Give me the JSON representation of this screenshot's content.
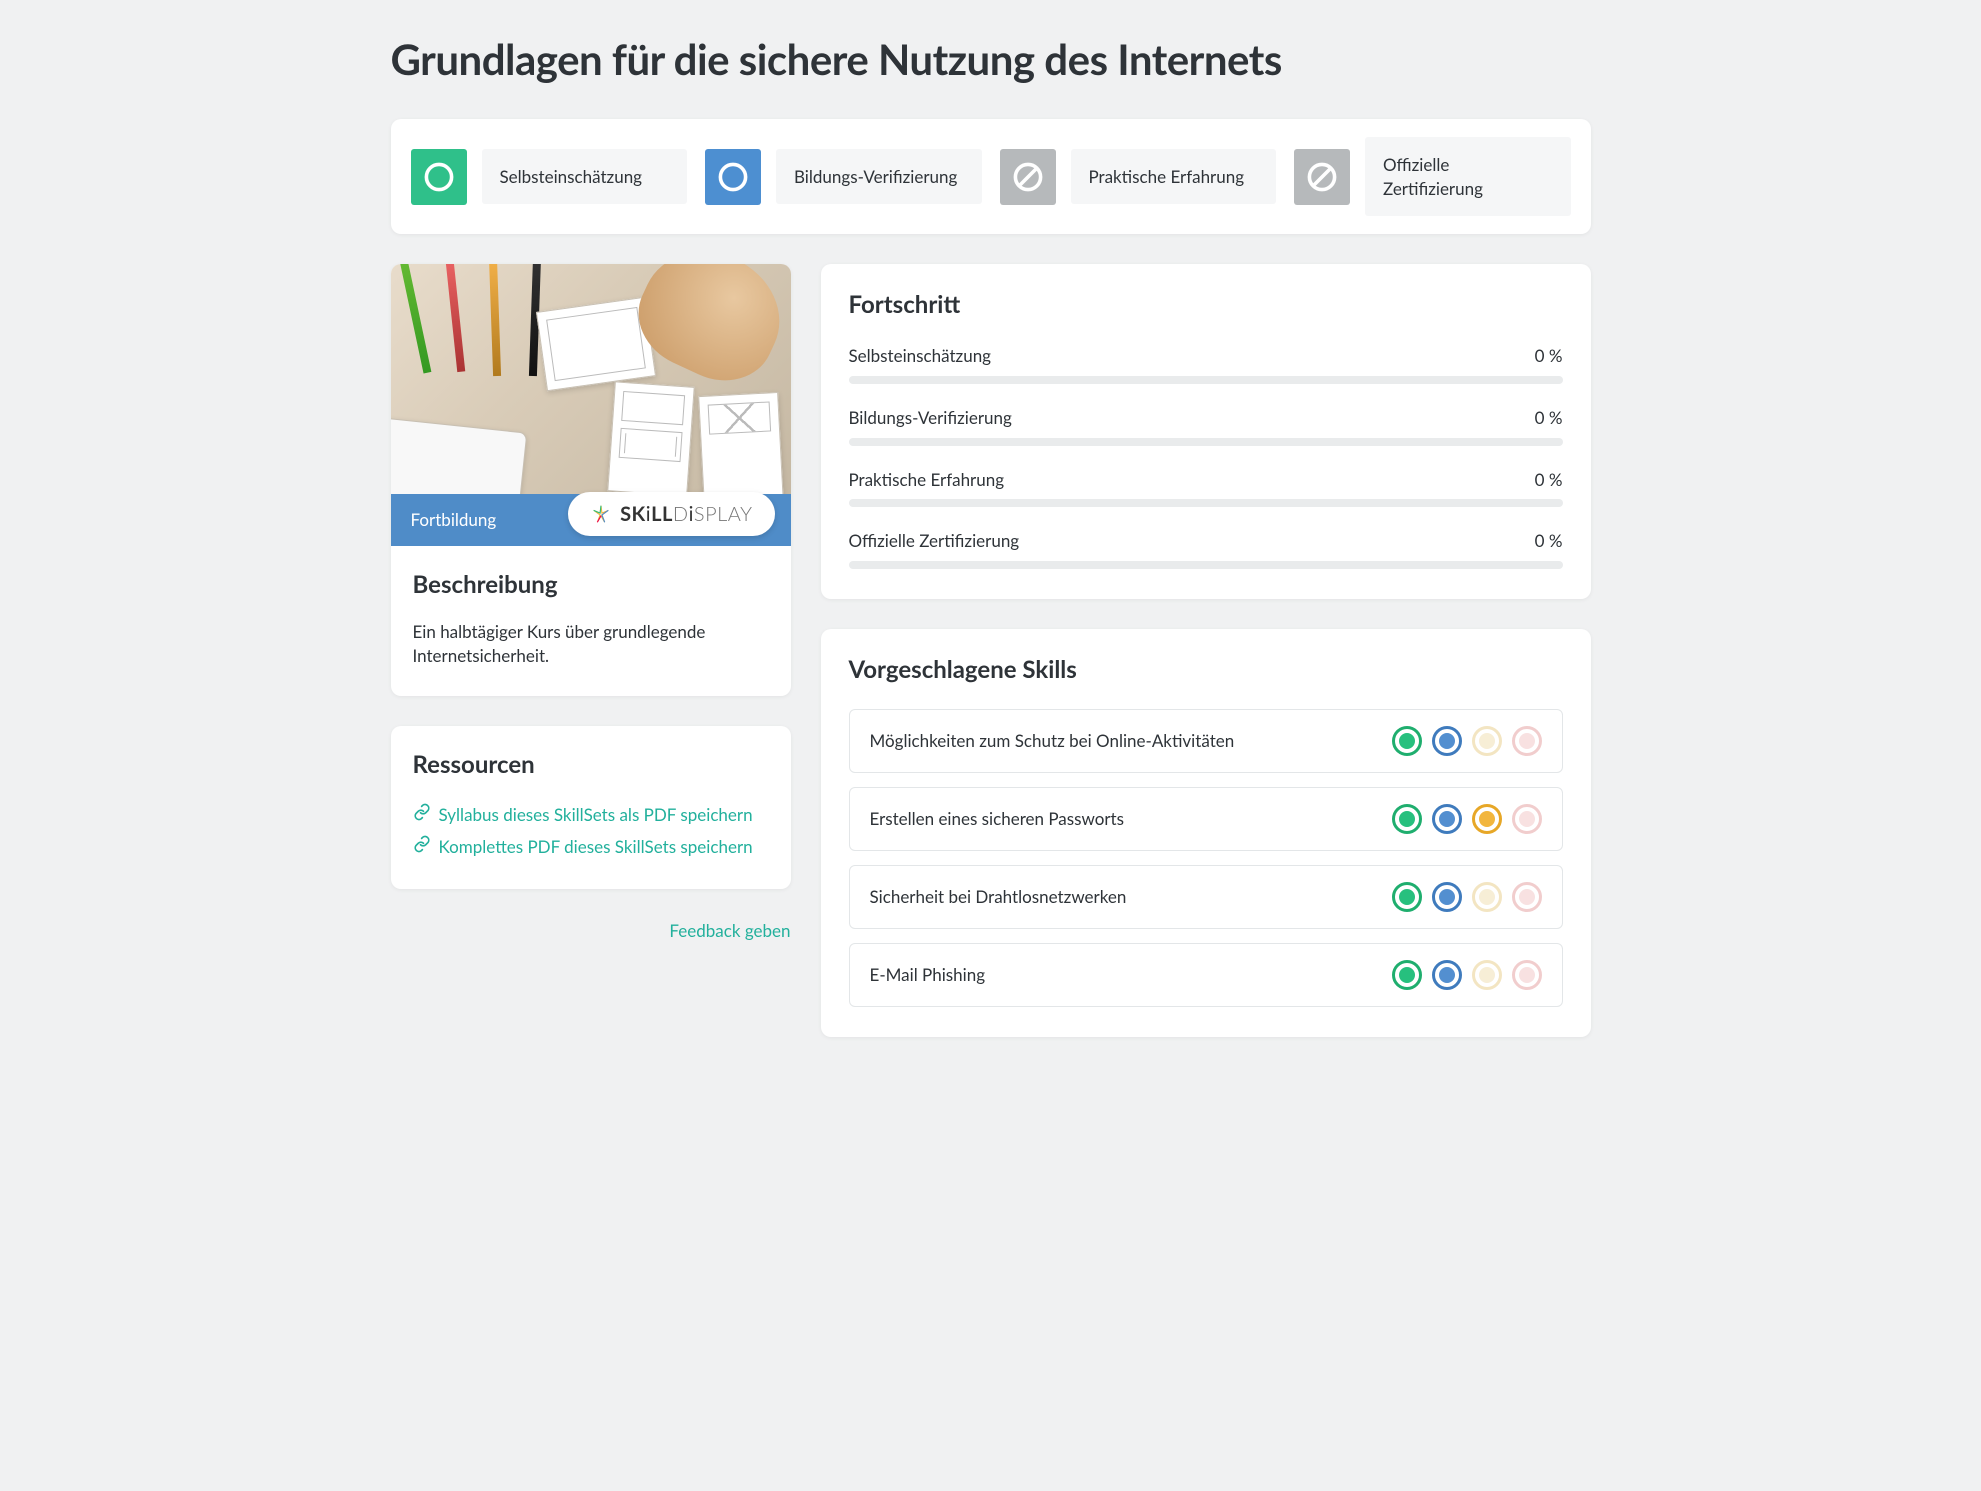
{
  "page": {
    "title": "Grundlagen für die sichere Nutzung des Internets"
  },
  "verification": {
    "items": [
      {
        "key": "self",
        "label": "Selbsteinschätzung",
        "icon": "circle",
        "color": "green",
        "enabled": true
      },
      {
        "key": "edu",
        "label": "Bildungs-Verifizierung",
        "icon": "circle",
        "color": "blue",
        "enabled": true
      },
      {
        "key": "practice",
        "label": "Praktische Erfahrung",
        "icon": "disabled",
        "color": "grey",
        "enabled": false
      },
      {
        "key": "cert",
        "label": "Offizielle Zertifizierung",
        "icon": "disabled",
        "color": "grey",
        "enabled": false
      }
    ]
  },
  "description": {
    "badge": "Fortbildung",
    "brand": "SKiLLDiSPLAY",
    "heading": "Beschreibung",
    "text": "Ein halbtägiger Kurs über grundlegende Internetsicherheit."
  },
  "resources": {
    "heading": "Ressourcen",
    "links": [
      {
        "label": "Syllabus dieses SkillSets als PDF speichern"
      },
      {
        "label": "Komplettes PDF dieses SkillSets speichern"
      }
    ]
  },
  "feedback": {
    "label": "Feedback geben"
  },
  "progress": {
    "heading": "Fortschritt",
    "items": [
      {
        "label": "Selbsteinschätzung",
        "value": "0 %"
      },
      {
        "label": "Bildungs-Verifizierung",
        "value": "0 %"
      },
      {
        "label": "Praktische Erfahrung",
        "value": "0 %"
      },
      {
        "label": "Offizielle Zertifizierung",
        "value": "0 %"
      }
    ]
  },
  "skills": {
    "heading": "Vorgeschlagene Skills",
    "items": [
      {
        "name": "Möglichkeiten zum Schutz bei Online-Aktivitäten",
        "dots": [
          "green",
          "blue",
          "yellow-faded",
          "pink-faded"
        ]
      },
      {
        "name": "Erstellen eines sicheren Passworts",
        "dots": [
          "green",
          "blue",
          "yellow",
          "pink-faded"
        ]
      },
      {
        "name": "Sicherheit bei Drahtlosnetzwerken",
        "dots": [
          "green",
          "blue",
          "yellow-faded",
          "pink-faded"
        ]
      },
      {
        "name": "E-Mail Phishing",
        "dots": [
          "green",
          "blue",
          "yellow-faded",
          "pink-faded"
        ]
      }
    ]
  }
}
